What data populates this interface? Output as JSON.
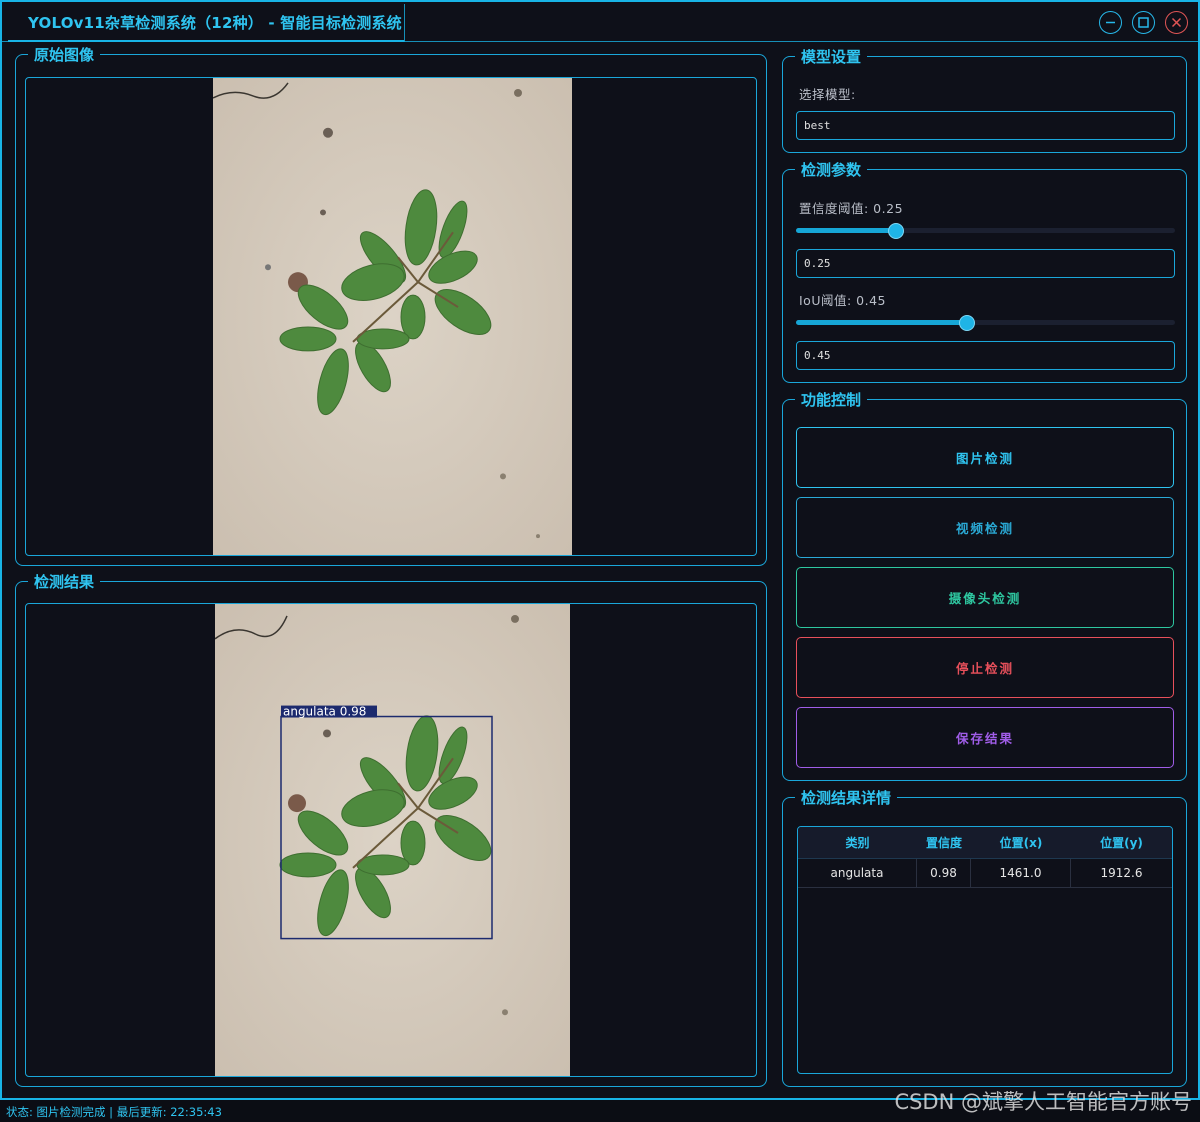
{
  "window": {
    "title": "YOLOv11杂草检测系统（12种） - 智能目标检测系统",
    "controls": [
      "minimize-icon",
      "maximize-icon",
      "close-icon"
    ]
  },
  "panels": {
    "original_title": "原始图像",
    "result_title": "检测结果"
  },
  "detection_overlay": {
    "label": "angulata 0.98"
  },
  "model_settings": {
    "title": "模型设置",
    "select_label": "选择模型:",
    "selected_model": "best"
  },
  "detection_params": {
    "title": "检测参数",
    "confidence_label": "置信度阈值: 0.25",
    "confidence_value": "0.25",
    "confidence": 0.25,
    "iou_label": "IoU阈值: 0.45",
    "iou_value": "0.45",
    "iou": 0.45
  },
  "function_control": {
    "title": "功能控制",
    "buttons": [
      {
        "label": "图片检测",
        "color": "#2fc4f0"
      },
      {
        "label": "视频检测",
        "color": "#2aaad6"
      },
      {
        "label": "摄像头检测",
        "color": "#2ec7a0"
      },
      {
        "label": "停止检测",
        "color": "#e8505b"
      },
      {
        "label": "保存结果",
        "color": "#a05de8"
      }
    ]
  },
  "results_details": {
    "title": "检测结果详情",
    "columns": [
      "类别",
      "置信度",
      "位置(x)",
      "位置(y)"
    ],
    "rows": [
      [
        "angulata",
        "0.98",
        "1461.0",
        "1912.6"
      ]
    ]
  },
  "status": {
    "text": "状态: 图片检测完成 | 最后更新: 22:35:43"
  },
  "watermark": "CSDN @斌擎人工智能官方账号",
  "colors": {
    "accent": "#18b4e6",
    "background": "#0e1019",
    "detection_box": "#1c2a6e"
  }
}
